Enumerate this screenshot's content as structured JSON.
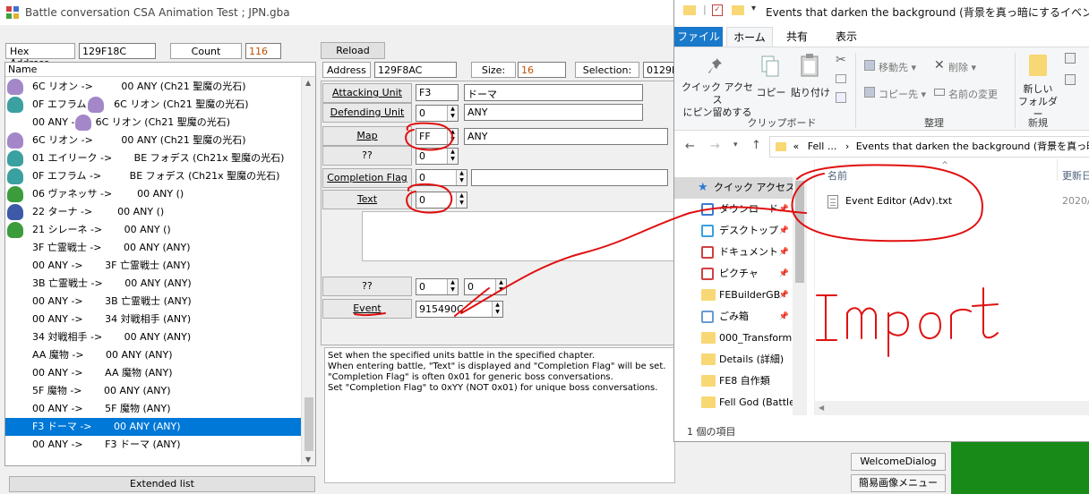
{
  "app": {
    "title": "Battle conversation CSA Animation Test ; JPN.gba",
    "hex_address_label": "Hex Address",
    "hex_address": "129F18C",
    "count_label": "Count",
    "count": "116",
    "reload": "Reload",
    "name_header": "Name",
    "extended_list": "Extended list",
    "list": [
      {
        "text": "6C リオン ->         00 ANY (Ch21 聖魔の光石)",
        "p": "#a487c9"
      },
      {
        "text": "0F エフラム ->    6C リオン (Ch21 聖魔の光石)",
        "p": "#3aa0a0",
        "p2": "#a487c9"
      },
      {
        "text": "00 ANY ->    6C リオン (Ch21 聖魔の光石)",
        "p2": "#a487c9"
      },
      {
        "text": "6C リオン ->         00 ANY (Ch21 聖魔の光石)",
        "p": "#a487c9"
      },
      {
        "text": "01 エイリーク ->       BE フォデス (Ch21x 聖魔の光石)",
        "p": "#3aa0a0"
      },
      {
        "text": "0F エフラム ->         BE フォデス (Ch21x 聖魔の光石)",
        "p": "#3aa0a0"
      },
      {
        "text": "06 ヴァネッサ ->        00 ANY ()",
        "p": "#3c9c3c"
      },
      {
        "text": "22 ターナ ->        00 ANY ()",
        "p": "#3c5aa8"
      },
      {
        "text": "21 シレーネ ->       00 ANY ()",
        "p": "#3c9c3c"
      },
      {
        "text": "3F 亡霊戦士 ->       00 ANY (ANY)"
      },
      {
        "text": "00 ANY ->       3F 亡霊戦士 (ANY)"
      },
      {
        "text": "3B 亡霊戦士 ->       00 ANY (ANY)"
      },
      {
        "text": "00 ANY ->       3B 亡霊戦士 (ANY)"
      },
      {
        "text": "00 ANY ->       34 対戦相手 (ANY)"
      },
      {
        "text": "34 対戦相手 ->       00 ANY (ANY)"
      },
      {
        "text": "AA 魔物 ->       00 ANY (ANY)"
      },
      {
        "text": "00 ANY ->       AA 魔物 (ANY)"
      },
      {
        "text": "5F 魔物 ->       00 ANY (ANY)"
      },
      {
        "text": "00 ANY ->       5F 魔物 (ANY)"
      },
      {
        "text": "F3 ドーマ ->       00 ANY (ANY)",
        "selected": true
      },
      {
        "text": "00 ANY ->       F3 ドーマ (ANY)"
      }
    ],
    "address_label": "Address",
    "address": "129F8AC",
    "size_label": "Size:",
    "size": "16",
    "selection_label": "Selection:",
    "selection": "0129F",
    "attacking_unit_label": "Attacking Unit",
    "attacking_unit": "F3",
    "attacking_unit_name": "ドーマ",
    "defending_unit_label": "Defending Unit",
    "defending_unit": "0",
    "defending_unit_name": "ANY",
    "map_label": "Map",
    "map": "FF",
    "map_name": "ANY",
    "unk1_label": "??",
    "unk1": "0",
    "completion_flag_label": "Completion Flag",
    "completion_flag": "0",
    "text_label": "Text",
    "text": "0",
    "unk2_label": "??",
    "unk2a": "0",
    "unk2b": "0",
    "event_label": "Event",
    "event": "915490C",
    "description": [
      "Set when the specified units battle in the specified chapter.",
      "When entering battle, \"Text\" is displayed and \"Completion Flag\" will be set.",
      "\"Completion Flag\" is often 0x01 for generic boss conversations.",
      "Set \"Completion Flag\" to 0xYY (NOT 0x01) for unique boss conversations."
    ],
    "welcome_dialog": "WelcomeDialog",
    "simple_image_menu": "簡易画像メニュー"
  },
  "explorer": {
    "title": "Events that darken the background (背景を真っ暗にするイベント)",
    "tabs": [
      "ファイル",
      "ホーム",
      "共有",
      "表示"
    ],
    "ribbon": {
      "quick_access": "クイック アクセス\nにピン留めする",
      "copy": "コピー",
      "paste": "貼り付け",
      "clipboard_group": "クリップボード",
      "move_to": "移動先",
      "copy_to": "コピー先",
      "delete": "削除",
      "rename": "名前の変更",
      "organize_group": "整理",
      "new_folder": "新しい\nフォルダー",
      "new_group": "新規"
    },
    "breadcrumb_prefix": "«",
    "breadcrumb_1": "Fell ...",
    "breadcrumb_sep": "›",
    "breadcrumb_2": "Events that darken the background (背景を真っ暗...",
    "nav": [
      {
        "label": "クイック アクセス",
        "icon": "star-icon",
        "header": true
      },
      {
        "label": "ダウンロード",
        "icon": "download-icon",
        "pin": true
      },
      {
        "label": "デスクトップ",
        "icon": "desktop-icon",
        "pin": true
      },
      {
        "label": "ドキュメント",
        "icon": "documents-icon",
        "pin": true
      },
      {
        "label": "ピクチャ",
        "icon": "pictures-icon",
        "pin": true
      },
      {
        "label": "FEBuilderGB",
        "icon": "folder-icon",
        "pin": true
      },
      {
        "label": "ごみ箱",
        "icon": "recycle-bin-icon",
        "pin": true
      },
      {
        "label": "000_Transform",
        "icon": "folder-icon"
      },
      {
        "label": "Details (詳細)",
        "icon": "folder-icon"
      },
      {
        "label": "FE8 自作類",
        "icon": "folder-icon"
      },
      {
        "label": "Fell God (Battle",
        "icon": "folder-icon"
      }
    ],
    "col_name": "名前",
    "col_date": "更新日",
    "file_name": "Event Editor (Adv).txt",
    "file_date": "2020/",
    "status": "1 個の項目"
  },
  "annotation": {
    "text": "Import",
    "color": "#e01010"
  }
}
